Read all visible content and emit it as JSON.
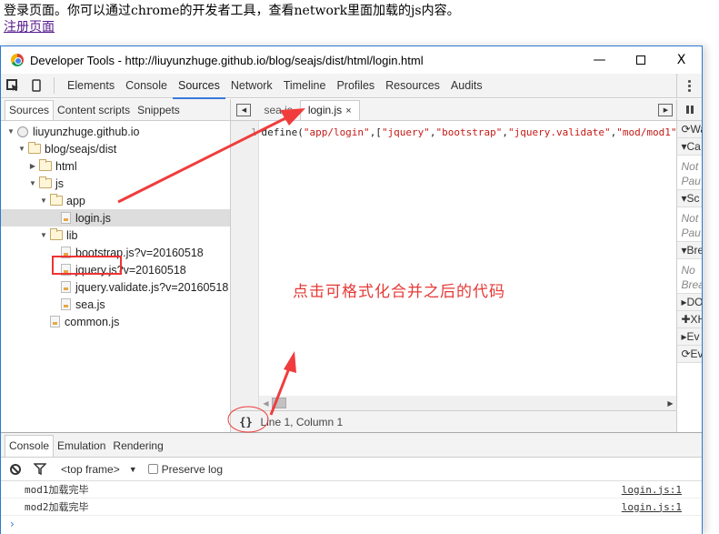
{
  "page": {
    "text": "登录页面。你可以通过chrome的开发者工具，查看network里面加载的js内容。",
    "link": "注册页面"
  },
  "window": {
    "title": "Developer Tools - http://liuyunzhuge.github.io/blog/seajs/dist/html/login.html",
    "minimize": "—",
    "close": "X"
  },
  "toolbar": {
    "tabs": [
      "Elements",
      "Console",
      "Sources",
      "Network",
      "Timeline",
      "Profiles",
      "Resources",
      "Audits"
    ],
    "active": "Sources"
  },
  "navigator": {
    "tabs": [
      "Sources",
      "Content scripts",
      "Snippets"
    ],
    "tree": [
      {
        "label": "liuyunzhuge.github.io",
        "type": "domain",
        "expanded": true
      },
      {
        "label": "blog/seajs/dist",
        "type": "folder",
        "expanded": true
      },
      {
        "label": "html",
        "type": "folder",
        "expanded": false
      },
      {
        "label": "js",
        "type": "folder",
        "expanded": true
      },
      {
        "label": "app",
        "type": "folder",
        "expanded": true
      },
      {
        "label": "login.js",
        "type": "file",
        "selected": true
      },
      {
        "label": "lib",
        "type": "folder",
        "expanded": true
      },
      {
        "label": "bootstrap.js?v=20160518",
        "type": "file"
      },
      {
        "label": "jquery.js?v=20160518",
        "type": "file"
      },
      {
        "label": "jquery.validate.js?v=20160518",
        "type": "file"
      },
      {
        "label": "sea.js",
        "type": "file"
      },
      {
        "label": "common.js",
        "type": "file"
      }
    ]
  },
  "editor": {
    "tabs": [
      {
        "label": "sea.js"
      },
      {
        "label": "login.js",
        "active": true,
        "close": "×"
      }
    ],
    "line_number": "1",
    "code": {
      "prefix": "define(",
      "s1": "\"app/login\"",
      "mid": ",[",
      "s2": "\"jquery\"",
      "c1": ",",
      "s3": "\"bootstrap\"",
      "c2": ",",
      "s4": "\"jquery.validate\"",
      "c3": ",",
      "s5": "\"mod/mod1\""
    },
    "pretty_print": "{}",
    "cursor_position": "Line 1, Column 1"
  },
  "debugger": {
    "watch": "Wa",
    "sections": [
      {
        "label": "Ca",
        "body": [
          "Not",
          "Pau"
        ]
      },
      {
        "label": "Sc",
        "body": [
          "Not",
          "Pau"
        ]
      },
      {
        "label": "Bre",
        "body": [
          "No",
          "Brea"
        ]
      }
    ],
    "collapsed": [
      "DO",
      "XH",
      "Ev",
      "Ev"
    ]
  },
  "annotation": "点击可格式化合并之后的代码",
  "drawer": {
    "tabs": [
      "Console",
      "Emulation",
      "Rendering"
    ],
    "frame": "<top frame>",
    "preserve_log": "Preserve log",
    "messages": [
      {
        "text": "mod1加载完毕",
        "source": "login.js:1"
      },
      {
        "text": "mod2加载完毕",
        "source": "login.js:1"
      }
    ],
    "prompt": "›"
  }
}
